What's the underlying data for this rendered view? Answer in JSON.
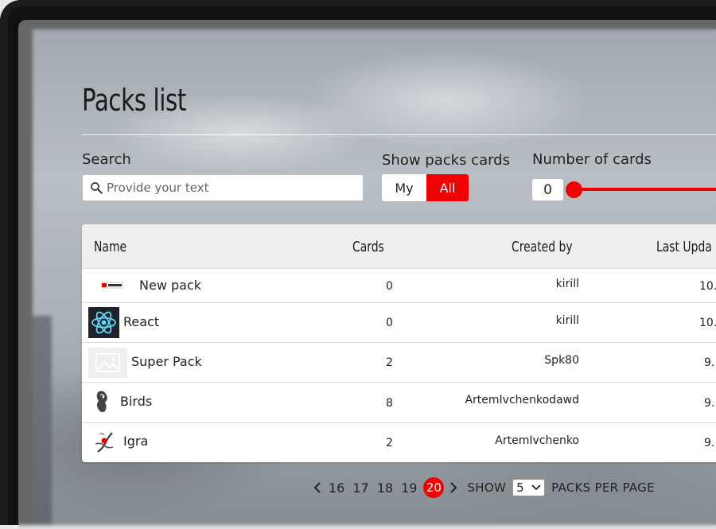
{
  "page": {
    "title": "Packs list"
  },
  "filters": {
    "search_label": "Search",
    "search_placeholder": "Provide your text",
    "show_label": "Show packs cards",
    "toggle": {
      "my": "My",
      "all": "All",
      "selected": "All"
    },
    "number_label": "Number of cards",
    "min_value": "0"
  },
  "table": {
    "columns": [
      "Name",
      "Cards",
      "Created by",
      "Last Upda"
    ],
    "rows": [
      {
        "name": "New pack",
        "cards": "0",
        "created_by": "kirill",
        "updated": "10.",
        "thumb": "cover-logo"
      },
      {
        "name": "React",
        "cards": "0",
        "created_by": "kirill",
        "updated": "10.",
        "thumb": "react-logo"
      },
      {
        "name": "Super Pack",
        "cards": "2",
        "created_by": "Spk80",
        "updated": "9.",
        "thumb": "image-placeholder"
      },
      {
        "name": "Birds",
        "cards": "8",
        "created_by": "ArtemIvchenkodawd",
        "updated": "9.",
        "thumb": "bird-sketch"
      },
      {
        "name": "Igra",
        "cards": "2",
        "created_by": "ArtemIvchenko",
        "updated": "9.",
        "thumb": "figure-sketch"
      }
    ]
  },
  "pagination": {
    "pages": [
      "16",
      "17",
      "18",
      "19"
    ],
    "current": "20",
    "show_label": "SHOW",
    "per_page": "5",
    "per_page_label": "PACKS PER PAGE"
  },
  "colors": {
    "accent": "#f20000",
    "panel": "#ffffff",
    "header_bg": "#efefef"
  }
}
